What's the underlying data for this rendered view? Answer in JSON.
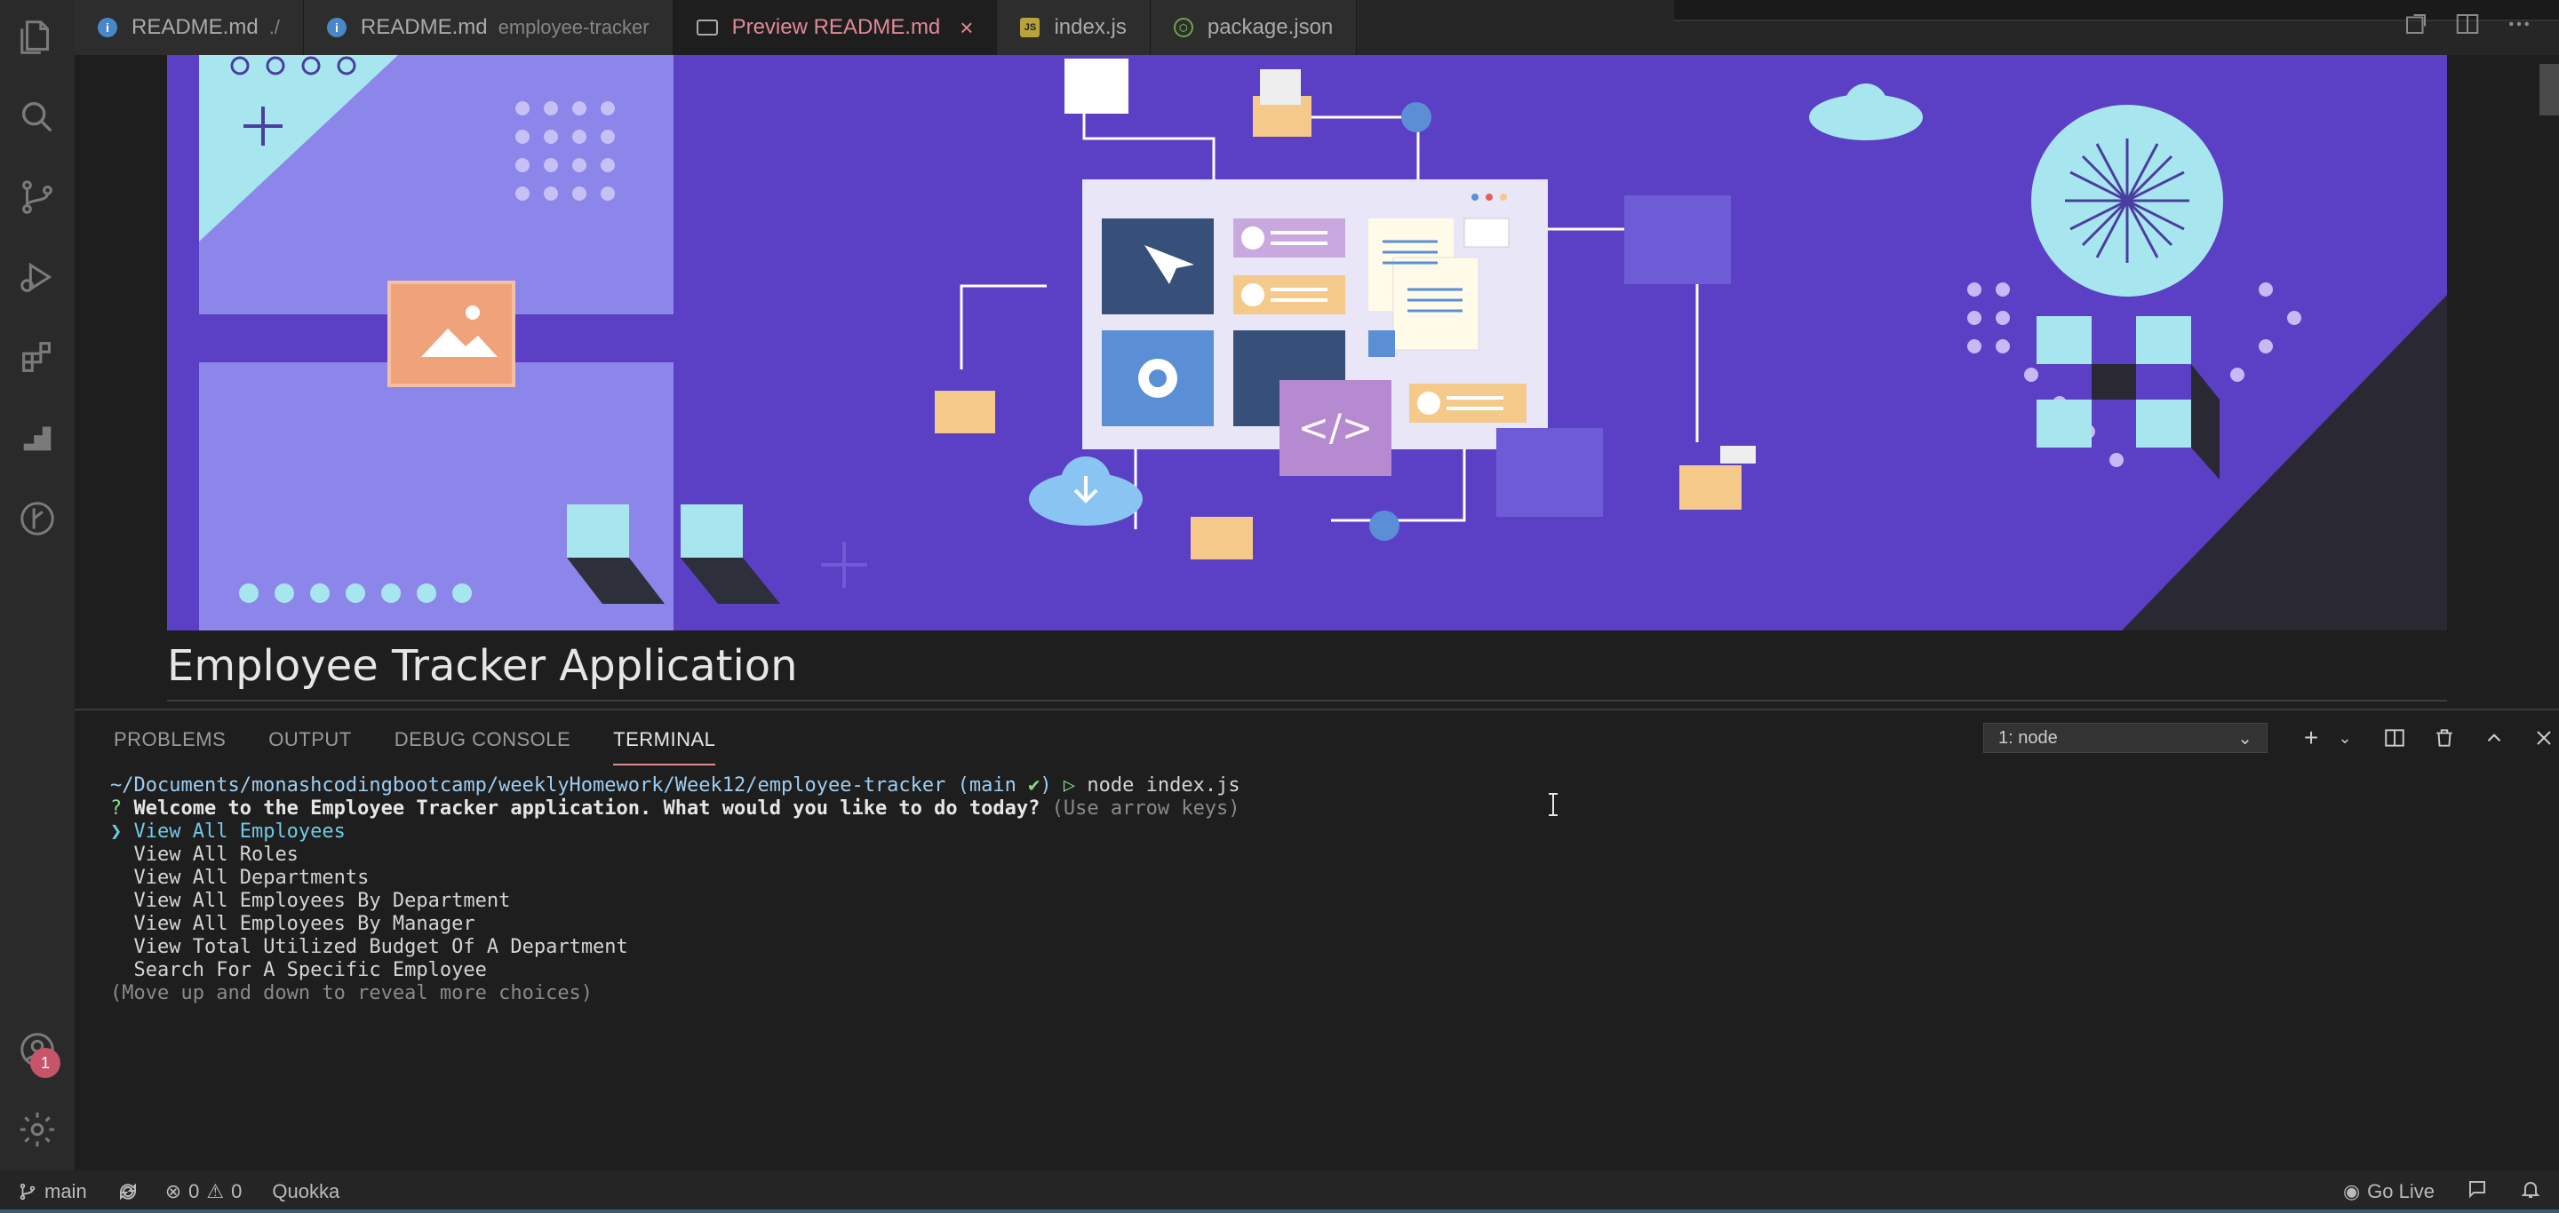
{
  "tabs": [
    {
      "label": "README.md",
      "desc": "./",
      "icon": "info-icon",
      "active": false
    },
    {
      "label": "README.md",
      "desc": "employee-tracker",
      "icon": "info-icon",
      "active": false
    },
    {
      "label": "Preview README.md",
      "desc": "",
      "icon": "preview-icon",
      "active": true
    },
    {
      "label": "index.js",
      "desc": "",
      "icon": "js-icon",
      "active": false
    },
    {
      "label": "package.json",
      "desc": "",
      "icon": "node-icon",
      "active": false
    }
  ],
  "document": {
    "title": "Employee Tracker Application"
  },
  "panel": {
    "tabs": [
      "PROBLEMS",
      "OUTPUT",
      "DEBUG CONSOLE",
      "TERMINAL"
    ],
    "active_tab": "TERMINAL",
    "terminal_select": "1: node"
  },
  "terminal": {
    "path": "~/Documents/monashcodingbootcamp/weeklyHomework/Week12/employee-tracker",
    "branch": "(main ",
    "branch_mark": "✔",
    "branch_end": ")",
    "prompt_symbol": "▷",
    "command": "node index.js",
    "question_mark": "?",
    "question": "Welcome to the Employee Tracker application. What would you like to do today?",
    "hint": "(Use arrow keys)",
    "pointer": "❯",
    "choices": [
      "View All Employees",
      "View All Roles",
      "View All Departments",
      "View All Employees By Department",
      "View All Employees By Manager",
      "View Total Utilized Budget Of A Department",
      "Search For A Specific Employee"
    ],
    "footer": "(Move up and down to reveal more choices)"
  },
  "status": {
    "branch": "main",
    "errors": "0",
    "warnings": "0",
    "quokka": "Quokka",
    "go_live": "Go Live"
  },
  "notifications_badge": "1",
  "colors": {
    "accent": "#e08a96",
    "hero_purple": "#5b3fc4",
    "terminal_path": "#9ecdf2",
    "terminal_green": "#8bd88b",
    "selected_choice": "#71c9e6"
  }
}
